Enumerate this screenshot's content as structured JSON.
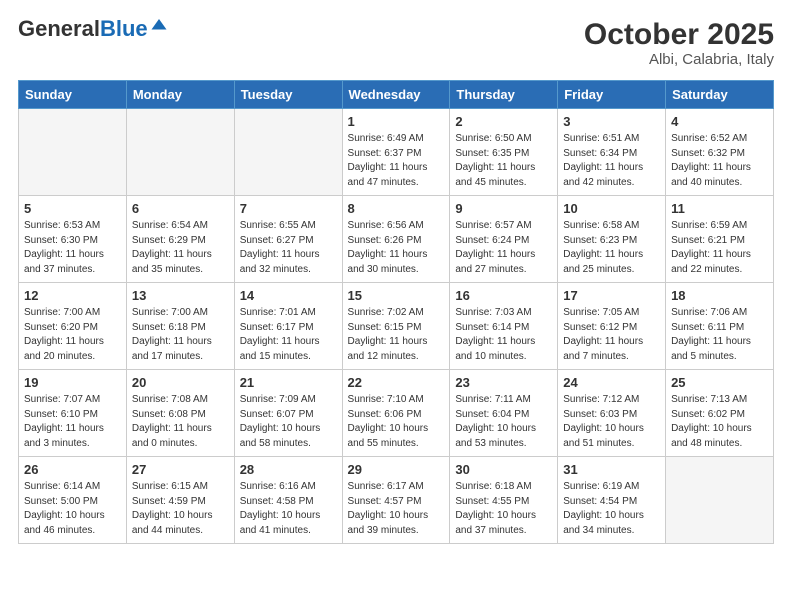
{
  "header": {
    "logo_general": "General",
    "logo_blue": "Blue",
    "month_title": "October 2025",
    "subtitle": "Albi, Calabria, Italy"
  },
  "weekdays": [
    "Sunday",
    "Monday",
    "Tuesday",
    "Wednesday",
    "Thursday",
    "Friday",
    "Saturday"
  ],
  "weeks": [
    [
      {
        "day": "",
        "info": ""
      },
      {
        "day": "",
        "info": ""
      },
      {
        "day": "",
        "info": ""
      },
      {
        "day": "1",
        "info": "Sunrise: 6:49 AM\nSunset: 6:37 PM\nDaylight: 11 hours\nand 47 minutes."
      },
      {
        "day": "2",
        "info": "Sunrise: 6:50 AM\nSunset: 6:35 PM\nDaylight: 11 hours\nand 45 minutes."
      },
      {
        "day": "3",
        "info": "Sunrise: 6:51 AM\nSunset: 6:34 PM\nDaylight: 11 hours\nand 42 minutes."
      },
      {
        "day": "4",
        "info": "Sunrise: 6:52 AM\nSunset: 6:32 PM\nDaylight: 11 hours\nand 40 minutes."
      }
    ],
    [
      {
        "day": "5",
        "info": "Sunrise: 6:53 AM\nSunset: 6:30 PM\nDaylight: 11 hours\nand 37 minutes."
      },
      {
        "day": "6",
        "info": "Sunrise: 6:54 AM\nSunset: 6:29 PM\nDaylight: 11 hours\nand 35 minutes."
      },
      {
        "day": "7",
        "info": "Sunrise: 6:55 AM\nSunset: 6:27 PM\nDaylight: 11 hours\nand 32 minutes."
      },
      {
        "day": "8",
        "info": "Sunrise: 6:56 AM\nSunset: 6:26 PM\nDaylight: 11 hours\nand 30 minutes."
      },
      {
        "day": "9",
        "info": "Sunrise: 6:57 AM\nSunset: 6:24 PM\nDaylight: 11 hours\nand 27 minutes."
      },
      {
        "day": "10",
        "info": "Sunrise: 6:58 AM\nSunset: 6:23 PM\nDaylight: 11 hours\nand 25 minutes."
      },
      {
        "day": "11",
        "info": "Sunrise: 6:59 AM\nSunset: 6:21 PM\nDaylight: 11 hours\nand 22 minutes."
      }
    ],
    [
      {
        "day": "12",
        "info": "Sunrise: 7:00 AM\nSunset: 6:20 PM\nDaylight: 11 hours\nand 20 minutes."
      },
      {
        "day": "13",
        "info": "Sunrise: 7:00 AM\nSunset: 6:18 PM\nDaylight: 11 hours\nand 17 minutes."
      },
      {
        "day": "14",
        "info": "Sunrise: 7:01 AM\nSunset: 6:17 PM\nDaylight: 11 hours\nand 15 minutes."
      },
      {
        "day": "15",
        "info": "Sunrise: 7:02 AM\nSunset: 6:15 PM\nDaylight: 11 hours\nand 12 minutes."
      },
      {
        "day": "16",
        "info": "Sunrise: 7:03 AM\nSunset: 6:14 PM\nDaylight: 11 hours\nand 10 minutes."
      },
      {
        "day": "17",
        "info": "Sunrise: 7:05 AM\nSunset: 6:12 PM\nDaylight: 11 hours\nand 7 minutes."
      },
      {
        "day": "18",
        "info": "Sunrise: 7:06 AM\nSunset: 6:11 PM\nDaylight: 11 hours\nand 5 minutes."
      }
    ],
    [
      {
        "day": "19",
        "info": "Sunrise: 7:07 AM\nSunset: 6:10 PM\nDaylight: 11 hours\nand 3 minutes."
      },
      {
        "day": "20",
        "info": "Sunrise: 7:08 AM\nSunset: 6:08 PM\nDaylight: 11 hours\nand 0 minutes."
      },
      {
        "day": "21",
        "info": "Sunrise: 7:09 AM\nSunset: 6:07 PM\nDaylight: 10 hours\nand 58 minutes."
      },
      {
        "day": "22",
        "info": "Sunrise: 7:10 AM\nSunset: 6:06 PM\nDaylight: 10 hours\nand 55 minutes."
      },
      {
        "day": "23",
        "info": "Sunrise: 7:11 AM\nSunset: 6:04 PM\nDaylight: 10 hours\nand 53 minutes."
      },
      {
        "day": "24",
        "info": "Sunrise: 7:12 AM\nSunset: 6:03 PM\nDaylight: 10 hours\nand 51 minutes."
      },
      {
        "day": "25",
        "info": "Sunrise: 7:13 AM\nSunset: 6:02 PM\nDaylight: 10 hours\nand 48 minutes."
      }
    ],
    [
      {
        "day": "26",
        "info": "Sunrise: 6:14 AM\nSunset: 5:00 PM\nDaylight: 10 hours\nand 46 minutes."
      },
      {
        "day": "27",
        "info": "Sunrise: 6:15 AM\nSunset: 4:59 PM\nDaylight: 10 hours\nand 44 minutes."
      },
      {
        "day": "28",
        "info": "Sunrise: 6:16 AM\nSunset: 4:58 PM\nDaylight: 10 hours\nand 41 minutes."
      },
      {
        "day": "29",
        "info": "Sunrise: 6:17 AM\nSunset: 4:57 PM\nDaylight: 10 hours\nand 39 minutes."
      },
      {
        "day": "30",
        "info": "Sunrise: 6:18 AM\nSunset: 4:55 PM\nDaylight: 10 hours\nand 37 minutes."
      },
      {
        "day": "31",
        "info": "Sunrise: 6:19 AM\nSunset: 4:54 PM\nDaylight: 10 hours\nand 34 minutes."
      },
      {
        "day": "",
        "info": ""
      }
    ]
  ]
}
